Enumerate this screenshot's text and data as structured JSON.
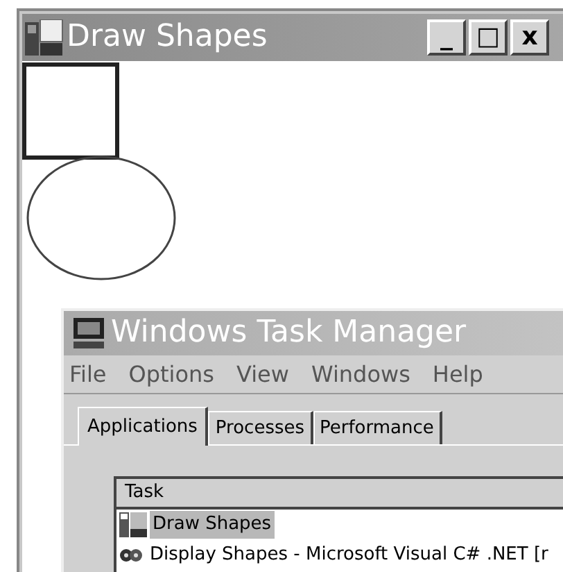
{
  "draw_window": {
    "title": "Draw Shapes",
    "controls": [
      "_",
      "□",
      "x"
    ]
  },
  "task_manager": {
    "title": "Windows Task Manager",
    "menu": [
      "File",
      "Options",
      "View",
      "Windows",
      "Help"
    ],
    "tabs": [
      {
        "label": "Applications",
        "selected": true
      },
      {
        "label": "Processes",
        "selected": false
      },
      {
        "label": "Performance",
        "selected": false
      }
    ],
    "table": {
      "columns": [
        "Task"
      ],
      "rows": [
        {
          "kind": "app",
          "task": "Draw Shapes",
          "selected": true
        },
        {
          "kind": "ide",
          "task": "Display Shapes - Microsoft Visual C# .NET [r",
          "selected": false
        }
      ]
    }
  }
}
